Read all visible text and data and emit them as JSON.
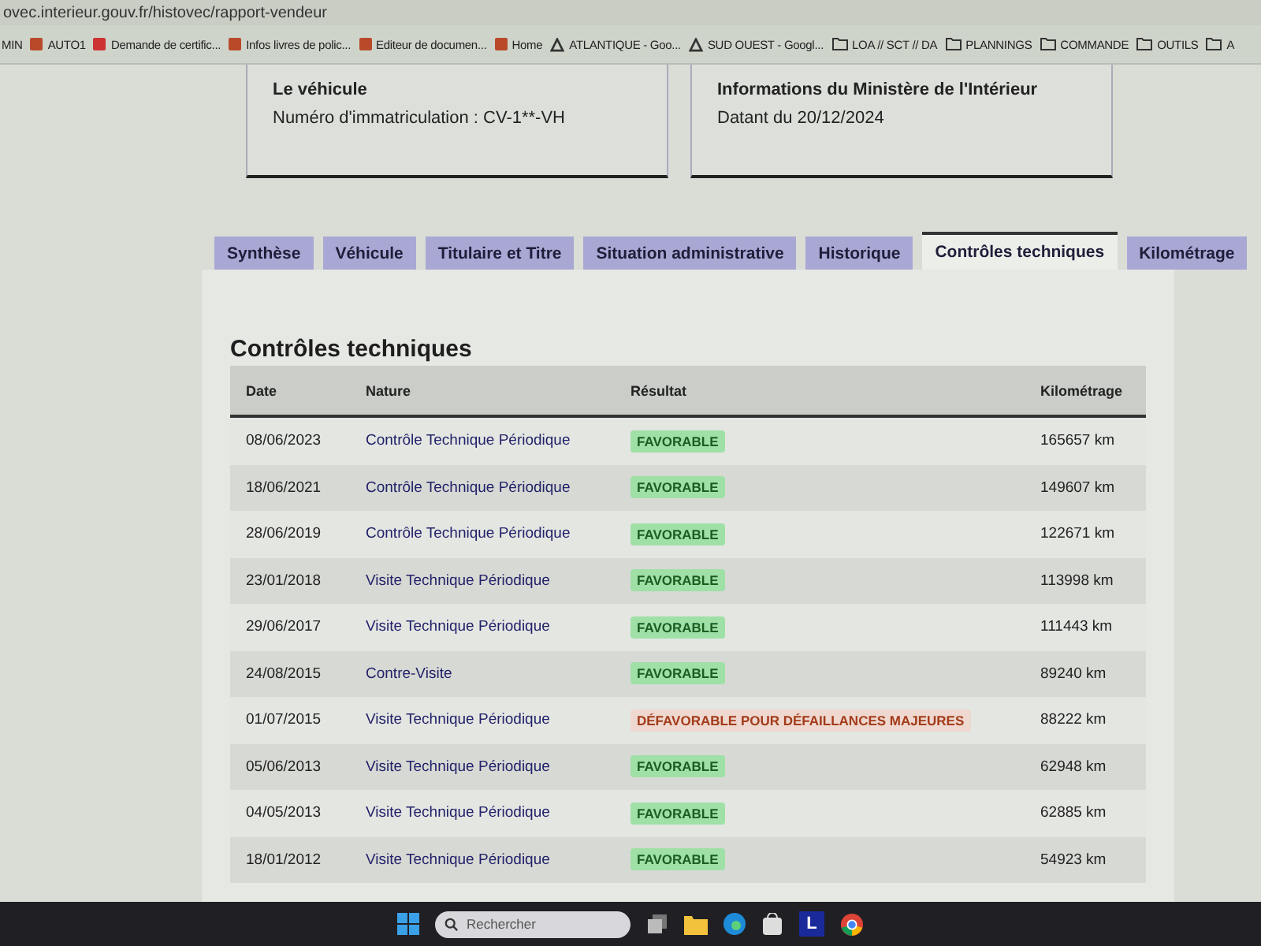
{
  "browser": {
    "url": "ovec.interieur.gouv.fr/histovec/rapport-vendeur",
    "bookmarks": [
      {
        "label": "MIN",
        "kind": "plain"
      },
      {
        "label": "AUTO1",
        "kind": "site"
      },
      {
        "label": "Demande de certific...",
        "kind": "flag"
      },
      {
        "label": "Infos livres de polic...",
        "kind": "site"
      },
      {
        "label": "Editeur de documen...",
        "kind": "site"
      },
      {
        "label": "Home",
        "kind": "site"
      },
      {
        "label": "ATLANTIQUE - Goo...",
        "kind": "drive"
      },
      {
        "label": "SUD OUEST - Googl...",
        "kind": "drive"
      },
      {
        "label": "LOA // SCT // DA",
        "kind": "folder"
      },
      {
        "label": "PLANNINGS",
        "kind": "folder"
      },
      {
        "label": "COMMANDE",
        "kind": "folder"
      },
      {
        "label": "OUTILS",
        "kind": "folder"
      },
      {
        "label": "A",
        "kind": "folder"
      }
    ]
  },
  "cards": [
    {
      "title": "Le véhicule",
      "text": "Numéro d'immatriculation : CV-1**-VH"
    },
    {
      "title": "Informations du Ministère de l'Intérieur",
      "text": "Datant du 20/12/2024"
    }
  ],
  "tabs": [
    {
      "label": "Synthèse",
      "selected": false
    },
    {
      "label": "Véhicule",
      "selected": false
    },
    {
      "label": "Titulaire et Titre",
      "selected": false
    },
    {
      "label": "Situation administrative",
      "selected": false
    },
    {
      "label": "Historique",
      "selected": false
    },
    {
      "label": "Contrôles techniques",
      "selected": true
    },
    {
      "label": "Kilométrage",
      "selected": false
    }
  ],
  "section_title": "Contrôles techniques",
  "table": {
    "columns": [
      "Date",
      "Nature",
      "Résultat",
      "Kilométrage"
    ],
    "rows": [
      {
        "date": "08/06/2023",
        "nature": "Contrôle Technique Périodique",
        "result": "FAVORABLE",
        "kind": "favorable",
        "km": "165657 km"
      },
      {
        "date": "18/06/2021",
        "nature": "Contrôle Technique Périodique",
        "result": "FAVORABLE",
        "kind": "favorable",
        "km": "149607 km"
      },
      {
        "date": "28/06/2019",
        "nature": "Contrôle Technique Périodique",
        "result": "FAVORABLE",
        "kind": "favorable",
        "km": "122671 km"
      },
      {
        "date": "23/01/2018",
        "nature": "Visite Technique Périodique",
        "result": "FAVORABLE",
        "kind": "favorable",
        "km": "113998 km"
      },
      {
        "date": "29/06/2017",
        "nature": "Visite Technique Périodique",
        "result": "FAVORABLE",
        "kind": "favorable",
        "km": "111443 km"
      },
      {
        "date": "24/08/2015",
        "nature": "Contre-Visite",
        "result": "FAVORABLE",
        "kind": "favorable",
        "km": "89240 km"
      },
      {
        "date": "01/07/2015",
        "nature": "Visite Technique Périodique",
        "result": "DÉFAVORABLE POUR DÉFAILLANCES MAJEURES",
        "kind": "defavorable",
        "km": "88222 km"
      },
      {
        "date": "05/06/2013",
        "nature": "Visite Technique Périodique",
        "result": "FAVORABLE",
        "kind": "favorable",
        "km": "62948 km"
      },
      {
        "date": "04/05/2013",
        "nature": "Visite Technique Périodique",
        "result": "FAVORABLE",
        "kind": "favorable",
        "km": "62885 km"
      },
      {
        "date": "18/01/2012",
        "nature": "Visite Technique Périodique",
        "result": "FAVORABLE",
        "kind": "favorable",
        "km": "54923 km"
      }
    ]
  },
  "taskbar": {
    "search_placeholder": "Rechercher",
    "app_letter": "L"
  }
}
